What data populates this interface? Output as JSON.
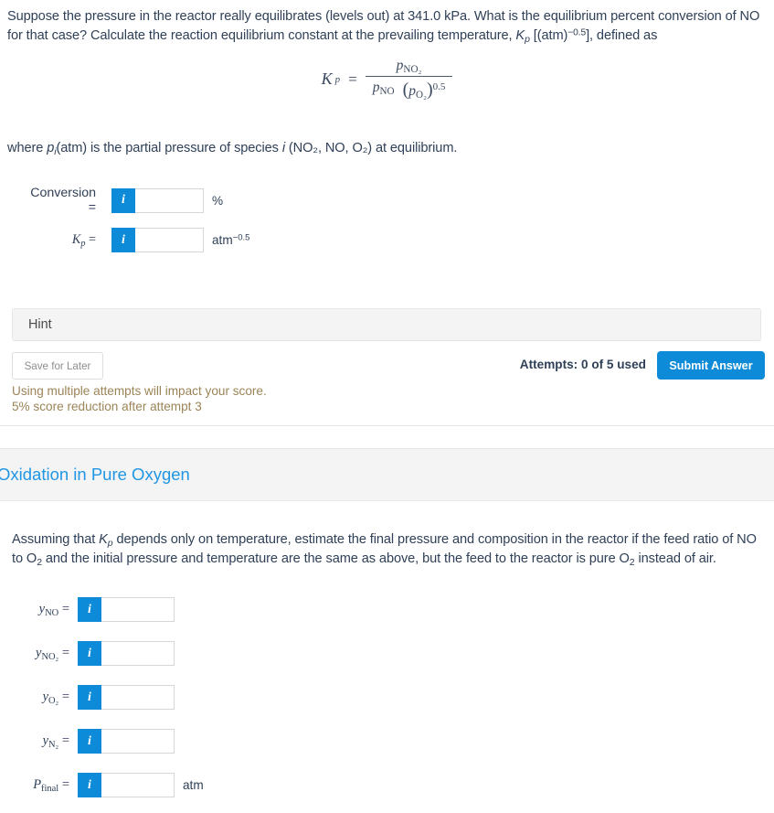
{
  "question1": {
    "paragraph_line1": "Suppose the pressure in the reactor really equilibrates (levels out) at 341.0 kPa. What is the equilibrium percent conversion of NO",
    "paragraph_line2_pre": "for that case? Calculate the reaction equilibrium constant at the prevailing temperature, ",
    "kp_symbol": "K",
    "kp_sub": "p",
    "paragraph_line2_mid": " [(atm)",
    "paragraph_line2_exp": "−0.5",
    "paragraph_line2_post": "], defined as",
    "formula": {
      "lhs_symbol": "K",
      "lhs_sub": "p",
      "equals": "=",
      "numerator_symbol": "p",
      "numerator_sub": "NO₂",
      "den_first_symbol": "p",
      "den_first_sub": "NO",
      "den_paren_open": "(",
      "den_second_symbol": "p",
      "den_second_sub": "O₂",
      "den_paren_close": ")",
      "den_exponent": "0.5"
    },
    "where_pre": "where ",
    "where_p": "p",
    "where_p_sub": "i",
    "where_mid": "(atm) is the partial pressure of species ",
    "where_i": "i",
    "where_species": " (NO₂, NO, O₂) at equilibrium.",
    "fields": [
      {
        "label": "Conversion =",
        "label_style": "plain",
        "info_glyph": "i",
        "value": "",
        "placeholder": "",
        "unit": "%",
        "unit_sup": ""
      },
      {
        "label": "K",
        "label_sub": "p",
        "label_suffix": " =",
        "label_style": "serif",
        "info_glyph": "i",
        "value": "",
        "placeholder": "",
        "unit": "atm",
        "unit_sup": "−0.5"
      }
    ],
    "hint_label": "Hint",
    "save_label": "Save for Later",
    "attempts_label": "Attempts: 0 of 5 used",
    "submit_label": "Submit Answer",
    "warning_line1": "Using multiple attempts will impact your score.",
    "warning_line2": "5% score reduction after attempt 3"
  },
  "section2": {
    "title": "Oxidation in Pure Oxygen",
    "paragraph_pre": "Assuming that ",
    "paragraph_kp": "K",
    "paragraph_kp_sub": "p",
    "paragraph_line1_post": " depends only on temperature, estimate the final pressure and composition in the reactor if the feed ratio of NO",
    "paragraph_line2": "to O₂ and the initial pressure and temperature are the same as above, but the feed to the reactor is pure O₂ instead of air.",
    "fields": [
      {
        "symbol": "y",
        "sub": "NO",
        "suffix": "=",
        "info_glyph": "i",
        "value": "",
        "placeholder": "",
        "unit": ""
      },
      {
        "symbol": "y",
        "sub": "NO₂",
        "suffix": "=",
        "info_glyph": "i",
        "value": "",
        "placeholder": "",
        "unit": ""
      },
      {
        "symbol": "y",
        "sub": "O₂",
        "suffix": "=",
        "info_glyph": "i",
        "value": "",
        "placeholder": "",
        "unit": ""
      },
      {
        "symbol": "y",
        "sub": "N₂",
        "suffix": "=",
        "info_glyph": "i",
        "value": "",
        "placeholder": "",
        "unit": ""
      },
      {
        "symbol": "P",
        "sub": "final",
        "suffix": "=",
        "info_glyph": "i",
        "value": "",
        "placeholder": "",
        "unit": "atm"
      }
    ]
  },
  "colors": {
    "accent_blue": "#0d8bd9",
    "link_blue": "#2196e3",
    "text_navy": "#2f4058",
    "warning_tan": "#9b8457",
    "band_gray": "#f4f4f5",
    "border_gray": "#e7e7e9"
  }
}
